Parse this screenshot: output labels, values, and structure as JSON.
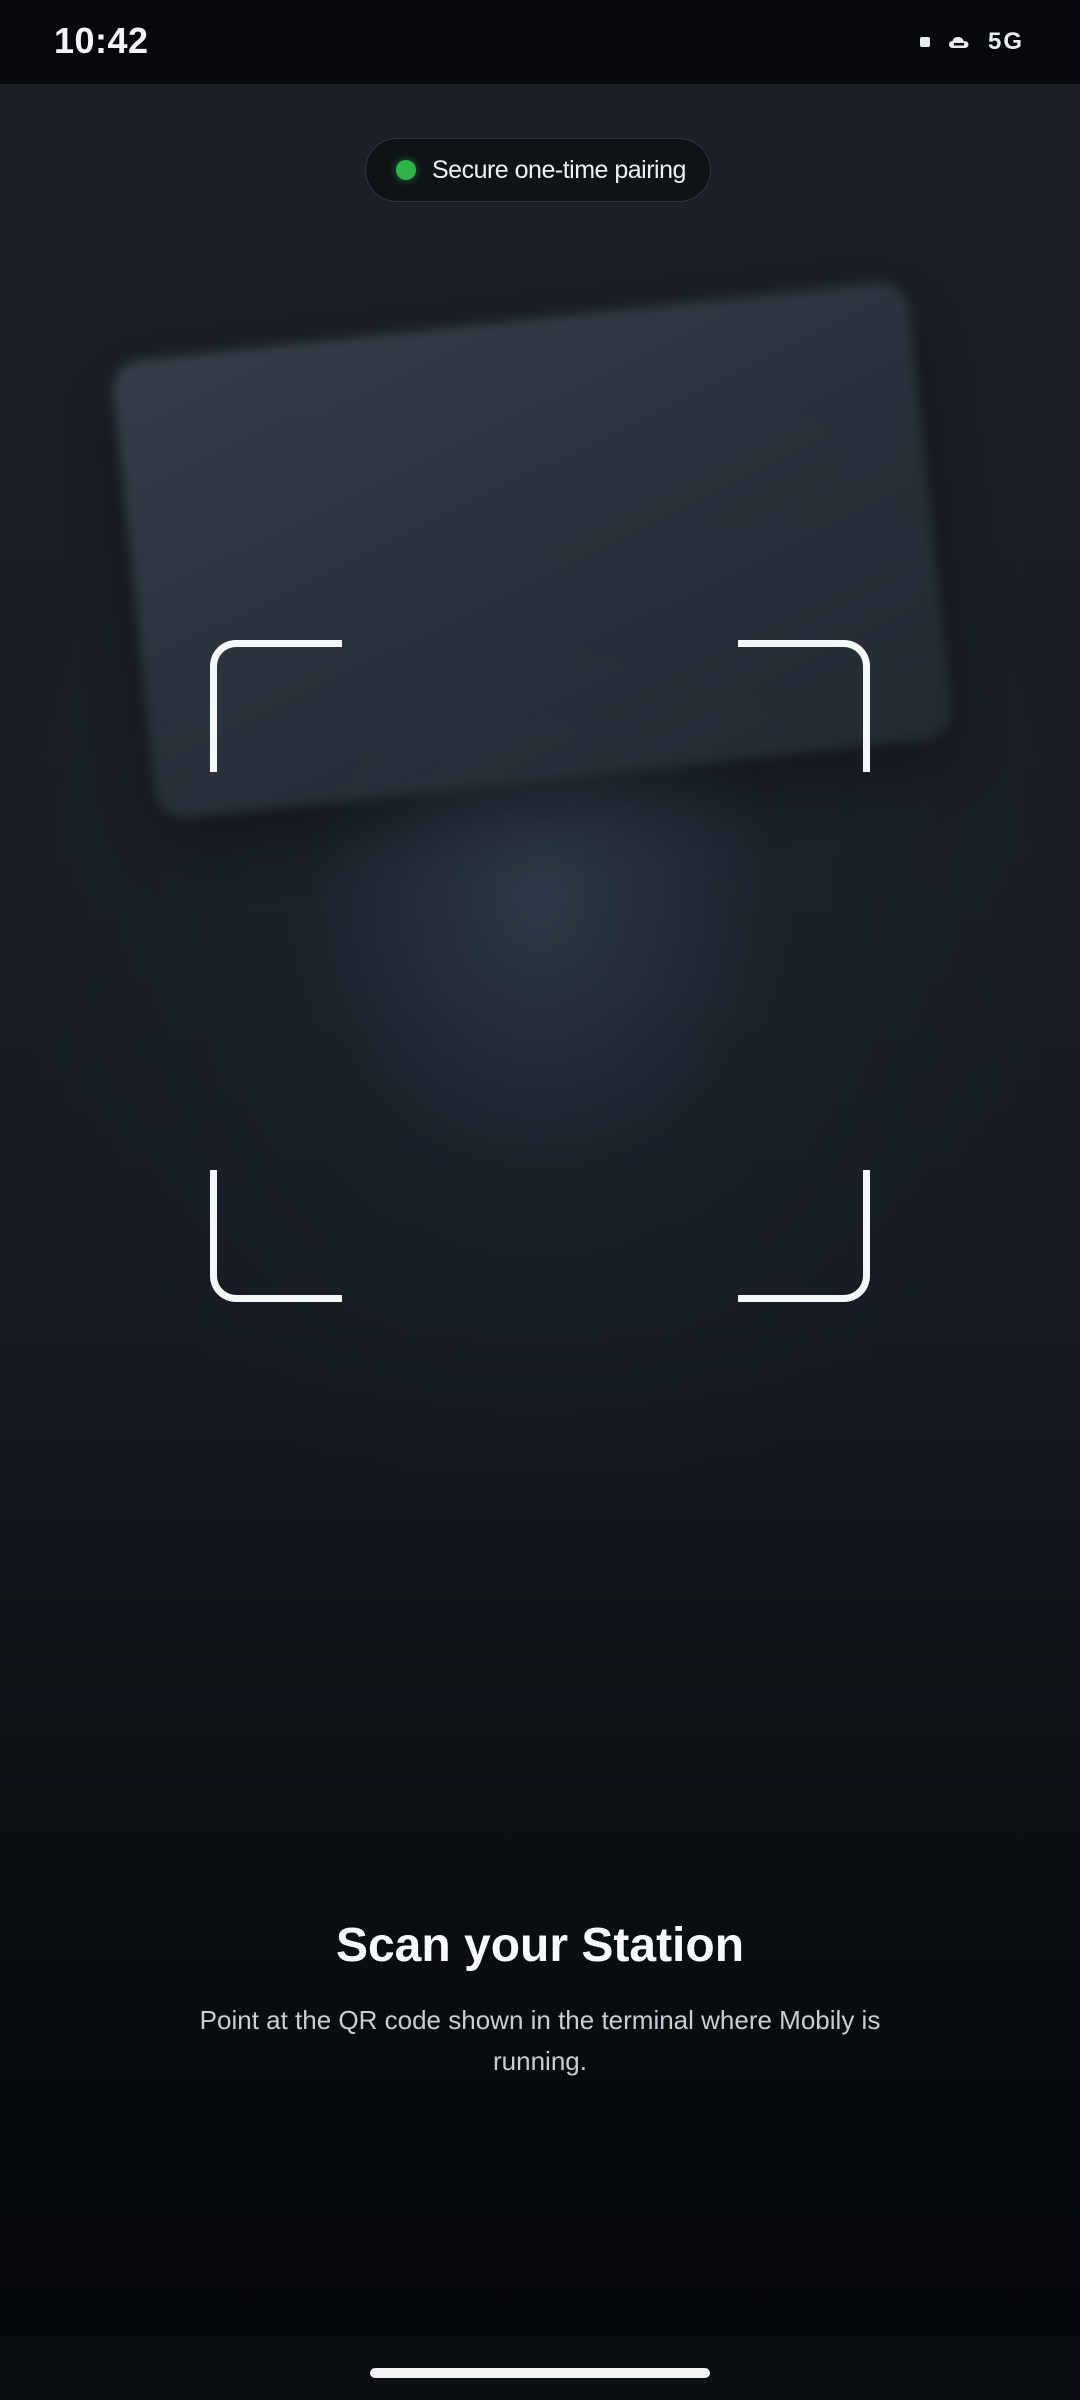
{
  "status_bar": {
    "time": "10:42",
    "network": "5G",
    "icons": [
      "signal-dot-icon",
      "cloud-icon"
    ]
  },
  "pairing_pill": {
    "label": "Secure one-time pairing",
    "dot_color": "#2fb34a"
  },
  "scanner": {
    "frame_color": "#f4f6f8"
  },
  "content": {
    "title": "Scan your Station",
    "subtitle": "Point at the QR code shown in the terminal where Mobily is running."
  },
  "nav_bar": {
    "home_indicator": "home-indicator"
  }
}
